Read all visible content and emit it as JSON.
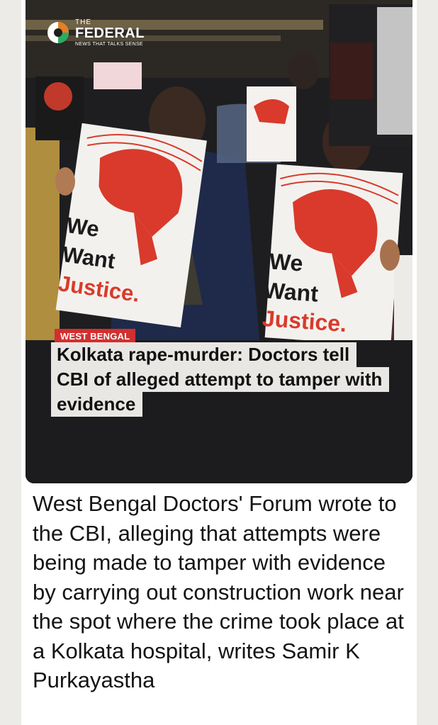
{
  "brand": {
    "the": "THE",
    "name": "FEDERAL",
    "tagline": "NEWS THAT TALKS SENSE"
  },
  "placards": {
    "we": "We",
    "want": "Want",
    "justice": "Justice."
  },
  "article": {
    "category": "WEST BENGAL",
    "headline": "Kolkata rape-murder: Doctors tell CBI of alleged attempt to tamper with evidence",
    "summary": "West Bengal Doctors' Forum wrote to the CBI, alleging that attempts were being made to tamper with evidence by carrying out construction work near the spot where the crime took place at a Kolkata hospital, writes Samir K Purkayastha"
  },
  "colors": {
    "accent": "#d32f2f",
    "page_bg": "#ecebe8",
    "headline_bg": "#e9e7e4"
  },
  "icons": [
    "the-federal-logo-icon"
  ]
}
